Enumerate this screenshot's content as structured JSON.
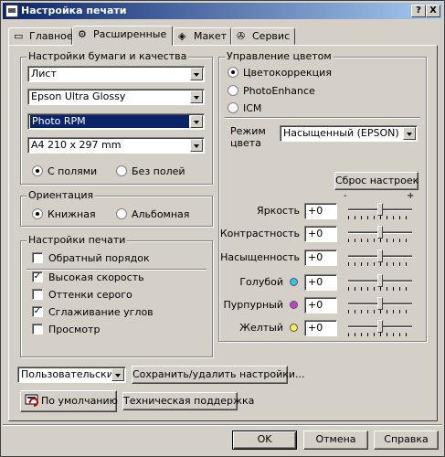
{
  "window": {
    "title": "Настройка печати",
    "help_btn": "?",
    "close_btn": "X"
  },
  "tabs": [
    {
      "label": "Главное",
      "icon": "page-icon"
    },
    {
      "label": "Расширенные",
      "icon": "gear-icon"
    },
    {
      "label": "Макет",
      "icon": "layout-icon"
    },
    {
      "label": "Сервис",
      "icon": "service-icon"
    }
  ],
  "paper": {
    "group_label": "Настройки бумаги и качества",
    "source": "Лист",
    "media": "Epson Ultra Glossy",
    "quality": "Photo RPM",
    "size": "A4 210 x 297 mm",
    "border_label": "С полями",
    "borderless_label": "Без полей"
  },
  "orientation": {
    "group_label": "Ориентация",
    "portrait": "Книжная",
    "landscape": "Альбомная"
  },
  "print_settings": {
    "group_label": "Настройки печати",
    "items": [
      {
        "label": "Обратный порядок",
        "checked": false
      },
      {
        "label": "Высокая скорость",
        "checked": true
      },
      {
        "label": "Оттенки серого",
        "checked": false
      },
      {
        "label": "Сглаживание углов",
        "checked": true
      },
      {
        "label": "Просмотр",
        "checked": false
      }
    ]
  },
  "color": {
    "group_label": "Управление цветом",
    "opt1": "Цветокоррекция",
    "opt2": "PhotoEnhance",
    "opt3": "ICM",
    "mode_label1": "Режим",
    "mode_label2": "цвета",
    "mode_value": "Насыщенный (EPSON)",
    "reset_btn": "Сброс настроек",
    "minus": "-",
    "plus": "+",
    "sliders": [
      {
        "label": "Яркость",
        "value": "+0",
        "dot": null
      },
      {
        "label": "Контрастность",
        "value": "+0",
        "dot": null
      },
      {
        "label": "Насыщенность",
        "value": "+0",
        "dot": null
      },
      {
        "label": "Голубой",
        "value": "+0",
        "dot": "#2ec5f0"
      },
      {
        "label": "Пурпурный",
        "value": "+0",
        "dot": "#c040d0"
      },
      {
        "label": "Желтый",
        "value": "+0",
        "dot": "#f0f050"
      }
    ]
  },
  "bottom": {
    "preset": "Пользовательские",
    "save_btn": "Сохранить/удалить настройки...",
    "default_btn": "По умолчанию",
    "support_btn": "Техническая поддержка"
  },
  "footer": {
    "ok": "OK",
    "cancel": "Отмена",
    "help": "Справка"
  }
}
